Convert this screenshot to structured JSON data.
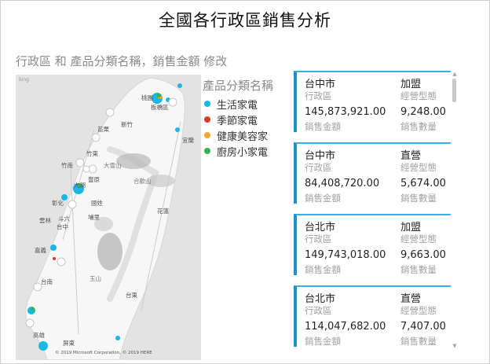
{
  "page": {
    "title": "全國各行政區銷售分析"
  },
  "map": {
    "title": "行政區 和 產品分類名稱，銷售金額 修改",
    "bing_label": "bing",
    "copyright": "© 2019 Microsoft Corporation, © 2019 HERE",
    "places": [
      {
        "label": "桃園"
      },
      {
        "label": "板橋區"
      },
      {
        "label": "竹東"
      },
      {
        "label": "竹南"
      },
      {
        "label": "大湖"
      },
      {
        "label": "豐原"
      },
      {
        "label": "彰化"
      },
      {
        "label": "國姓"
      },
      {
        "label": "埔里"
      },
      {
        "label": "斗六"
      },
      {
        "label": "雲林"
      },
      {
        "label": "台中"
      },
      {
        "label": "嘉義"
      },
      {
        "label": "台南"
      },
      {
        "label": "高雄"
      },
      {
        "label": "屏東"
      },
      {
        "label": "台東"
      },
      {
        "label": "花蓮"
      },
      {
        "label": "宜蘭"
      },
      {
        "label": "大雪山"
      },
      {
        "label": "合歡山"
      },
      {
        "label": "玉山"
      },
      {
        "label": "新竹"
      },
      {
        "label": "苗栗"
      }
    ]
  },
  "legend": {
    "title": "產品分類名稱",
    "items": [
      {
        "label": "生活家電",
        "color": "#19b7e6"
      },
      {
        "label": "季節家電",
        "color": "#d93a26"
      },
      {
        "label": "健康美容家",
        "color": "#f4a72b"
      },
      {
        "label": "廚房小家電",
        "color": "#34b44a"
      }
    ]
  },
  "cards": [
    {
      "district": "台中市",
      "district_label": "行政區",
      "type": "加盟",
      "type_label": "經營型態",
      "amount": "145,873,921.00",
      "amount_label": "銷售金額",
      "qty": "9,248.00",
      "qty_label": "銷售數量"
    },
    {
      "district": "台中市",
      "district_label": "行政區",
      "type": "直營",
      "type_label": "經營型態",
      "amount": "84,408,720.00",
      "amount_label": "銷售金額",
      "qty": "5,674.00",
      "qty_label": "銷售數量"
    },
    {
      "district": "台北市",
      "district_label": "行政區",
      "type": "加盟",
      "type_label": "經營型態",
      "amount": "149,743,018.00",
      "amount_label": "銷售金額",
      "qty": "9,663.00",
      "qty_label": "銷售數量"
    },
    {
      "district": "台北市",
      "district_label": "行政區",
      "type": "直營",
      "type_label": "經營型態",
      "amount": "114,047,682.00",
      "amount_label": "銷售金額",
      "qty": "7,407.00",
      "qty_label": "銷售數量"
    }
  ],
  "scrollbar": {
    "up_icon": "▲",
    "down_icon": "▼"
  }
}
